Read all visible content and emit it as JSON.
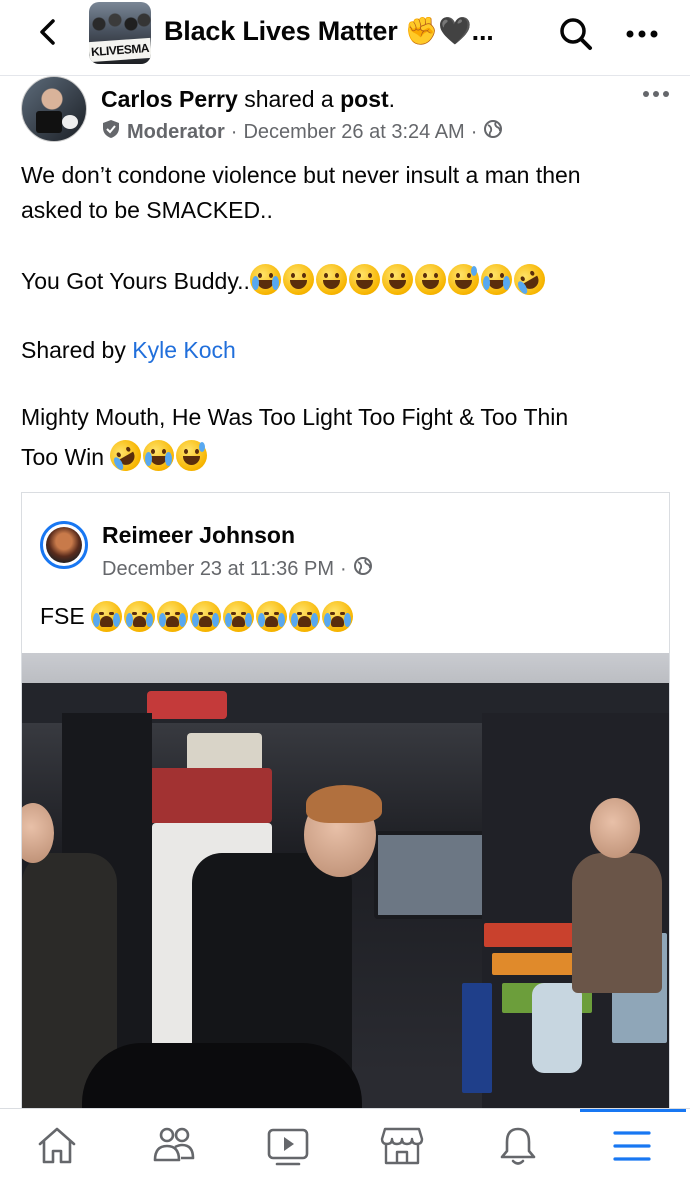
{
  "header": {
    "group_title": "Black Lives Matter ✊🖤...",
    "group_avatar_text": "KLIVESMA"
  },
  "post": {
    "author": "Carlos Perry",
    "action": "shared a",
    "action_link": "post",
    "role": "Moderator",
    "timestamp": "December 26 at 3:24 AM",
    "separator": "·",
    "line1": "We don’t condone violence but never insult a man then",
    "line2": "asked to be SMACKED..",
    "line3": "You Got Yours Buddy..",
    "line3_emojis": [
      "face-with-tears-of-joy",
      "squinting-face",
      "grinning-face",
      "grinning-face",
      "smiling-face",
      "grinning-face",
      "grinning-sweat",
      "face-with-tears-of-joy",
      "rolling-on-floor-laughing"
    ],
    "shared_by_prefix": "Shared by",
    "shared_by_name": "Kyle Koch",
    "line5": "Mighty Mouth, He Was Too Light Too Fight & Too Thin",
    "line6": "Too Win",
    "line6_emojis": [
      "rolling-on-floor-laughing",
      "face-with-tears-of-joy",
      "grinning-sweat"
    ]
  },
  "shared_card": {
    "author": "Reimeer Johnson",
    "timestamp": "December 23 at 11:36 PM",
    "separator": "·",
    "text": "FSE",
    "emojis": [
      "loudly-crying-face",
      "loudly-crying-face",
      "loudly-crying-face",
      "loudly-crying-face",
      "loudly-crying-face",
      "loudly-crying-face",
      "loudly-crying-face",
      "loudly-crying-face"
    ]
  },
  "bottom_nav": {
    "items": [
      "home-icon",
      "friends-icon",
      "watch-icon",
      "marketplace-icon",
      "notifications-icon",
      "menu-icon"
    ],
    "active": "menu-icon"
  },
  "colors": {
    "link": "#216fdb",
    "accent": "#1877f2",
    "meta": "#65676b"
  }
}
